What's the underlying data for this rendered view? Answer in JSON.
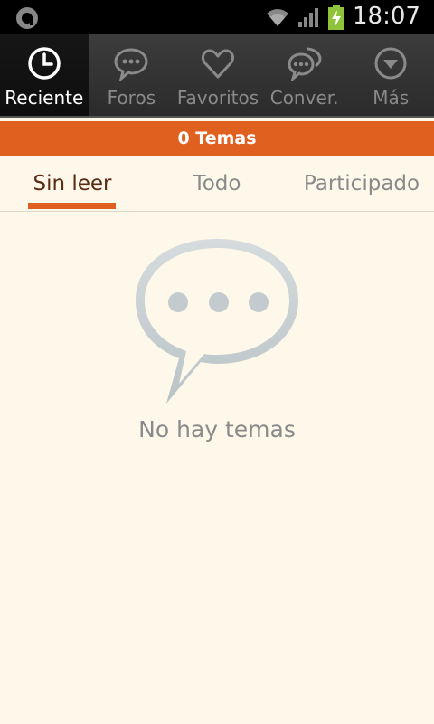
{
  "status_bar": {
    "time": "18:07"
  },
  "nav": {
    "items": [
      {
        "label": "Reciente",
        "icon": "clock-icon",
        "active": true
      },
      {
        "label": "Foros",
        "icon": "speech-bubble-icon"
      },
      {
        "label": "Favoritos",
        "icon": "heart-icon"
      },
      {
        "label": "Conver.",
        "icon": "conversation-icon"
      },
      {
        "label": "Más",
        "icon": "chevron-down-circle-icon"
      }
    ]
  },
  "count_bar": {
    "label": "0 Temas"
  },
  "tabs": [
    {
      "label": "Sin leer",
      "active": true
    },
    {
      "label": "Todo"
    },
    {
      "label": "Participado"
    }
  ],
  "empty_state": {
    "message": "No hay temas",
    "icon": "speech-bubble-icon"
  },
  "colors": {
    "accent": "#e0601f",
    "background": "#fdf8ea",
    "nav_bg": "#2f2f2f"
  }
}
